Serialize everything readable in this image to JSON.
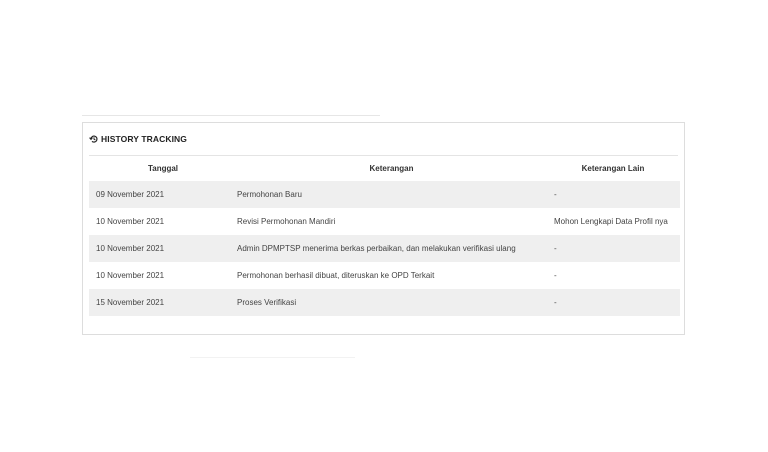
{
  "history": {
    "title": "HISTORY TRACKING",
    "icon": "history-icon",
    "columns": [
      "Tanggal",
      "Keterangan",
      "Keterangan Lain"
    ],
    "rows": [
      {
        "date": "09 November 2021",
        "note": "Permohonan Baru",
        "other": "-"
      },
      {
        "date": "10 November 2021",
        "note": "Revisi Permohonan Mandiri",
        "other": "Mohon Lengkapi Data Profil nya"
      },
      {
        "date": "10 November 2021",
        "note": "Admin DPMPTSP menerima berkas perbaikan, dan melakukan verifikasi ulang",
        "other": "-"
      },
      {
        "date": "10 November 2021",
        "note": "Permohonan berhasil dibuat, diteruskan ke OPD Terkait",
        "other": "-"
      },
      {
        "date": "15 November 2021",
        "note": "Proses Verifikasi",
        "other": "-"
      }
    ]
  },
  "colors": {
    "stripe": "#efefef",
    "border": "#dddddd"
  }
}
